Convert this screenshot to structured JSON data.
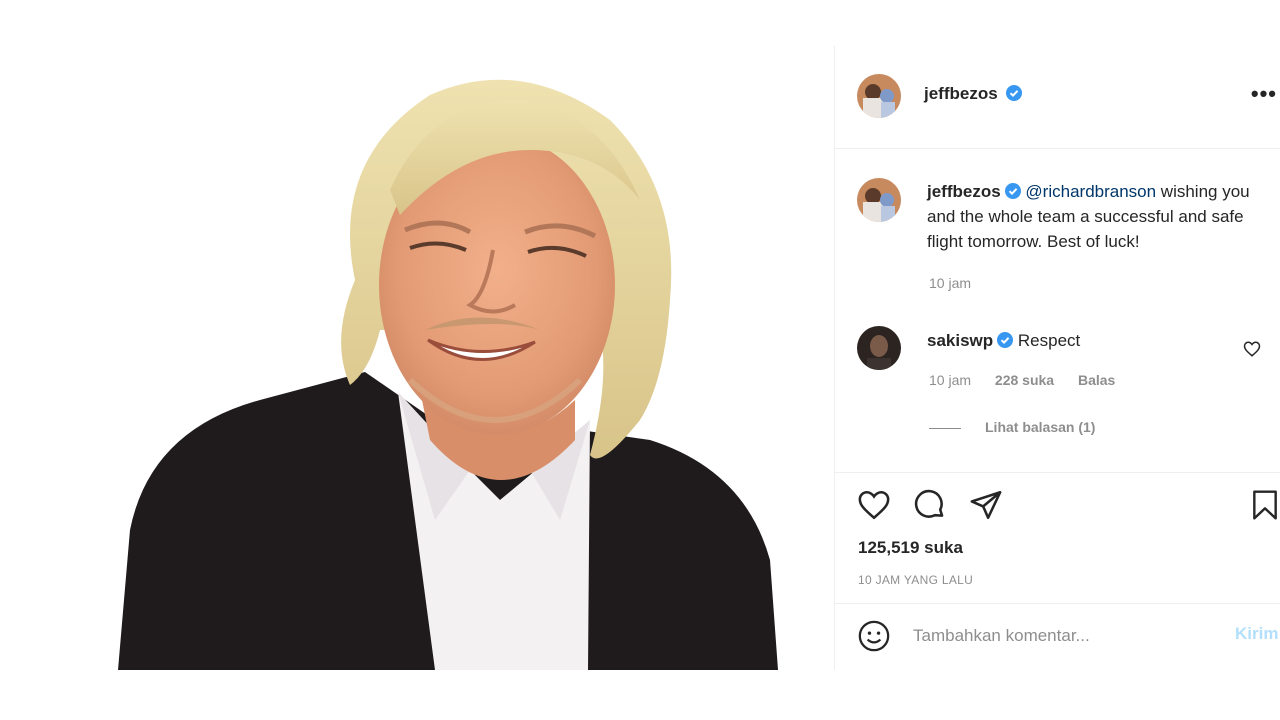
{
  "post": {
    "author": "jeffbezos",
    "verified": true,
    "caption_mention": "@richardbranson",
    "caption_text": " wishing you and the whole team a successful and safe flight tomorrow. Best of luck!",
    "caption_time": "10 jam"
  },
  "comments": [
    {
      "username": "sakiswp",
      "verified": true,
      "text": "Respect",
      "time": "10 jam",
      "likes": "228 suka",
      "reply_label": "Balas",
      "view_replies": "Lihat balasan (1)"
    }
  ],
  "stats": {
    "likes": "125,519 suka",
    "time_ago": "10 JAM YANG LALU"
  },
  "comment_box": {
    "placeholder": "Tambahkan komentar...",
    "post_label": "Kirim"
  },
  "icons": {
    "more": "more-options-icon",
    "like": "heart-icon",
    "comment": "comment-icon",
    "share": "paper-plane-icon",
    "save": "bookmark-icon",
    "emoji": "emoji-icon",
    "verified": "verified-badge-icon"
  },
  "colors": {
    "verified": "#3897f0",
    "link": "#00376b",
    "muted": "#8e8e8e",
    "post_button": "#b2dffc"
  }
}
